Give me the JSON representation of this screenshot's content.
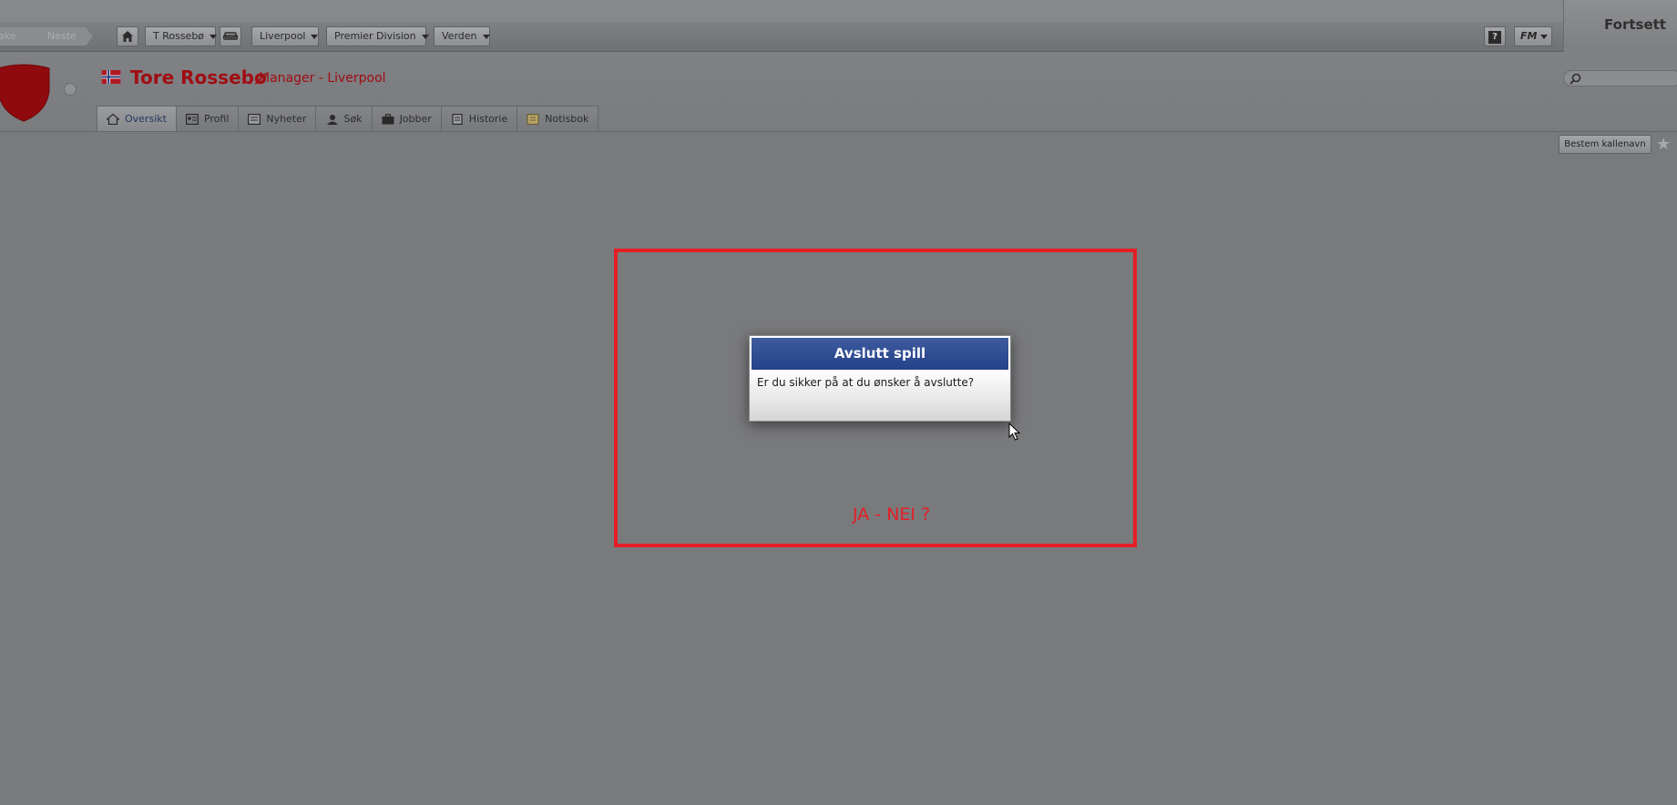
{
  "toolbar": {
    "back_label": "ake",
    "next_label": "Neste",
    "manager_menu": "T Rossebø",
    "club_menu": "Liverpool",
    "division_menu": "Premier Division",
    "world_menu": "Verden",
    "fm_label": "FM",
    "help_label": "?"
  },
  "continue_label": "Fortsett",
  "header": {
    "manager_name": "Tore Rossebø",
    "manager_role": "Manager - Liverpool",
    "search_placeholder": ""
  },
  "tabs": [
    {
      "label": "Oversikt",
      "icon": "home-icon",
      "active": true
    },
    {
      "label": "Profil",
      "icon": "profile-card-icon",
      "active": false
    },
    {
      "label": "Nyheter",
      "icon": "news-icon",
      "active": false
    },
    {
      "label": "Søk",
      "icon": "search-person-icon",
      "active": false
    },
    {
      "label": "Jobber",
      "icon": "briefcase-icon",
      "active": false
    },
    {
      "label": "Historie",
      "icon": "history-icon",
      "active": false
    },
    {
      "label": "Notisbok",
      "icon": "notebook-icon",
      "active": false
    }
  ],
  "nickname_button": "Bestem kallenavn",
  "dialog": {
    "title": "Avslutt spill",
    "message": "Er du sikker på at du ønsker å avslutte?"
  },
  "annotation": "JA - NEI ?",
  "colors": {
    "brand_red": "#a00d12",
    "dialog_blue": "#2c4a90",
    "annotation_red": "#e51e25",
    "background": "#797a7c"
  }
}
